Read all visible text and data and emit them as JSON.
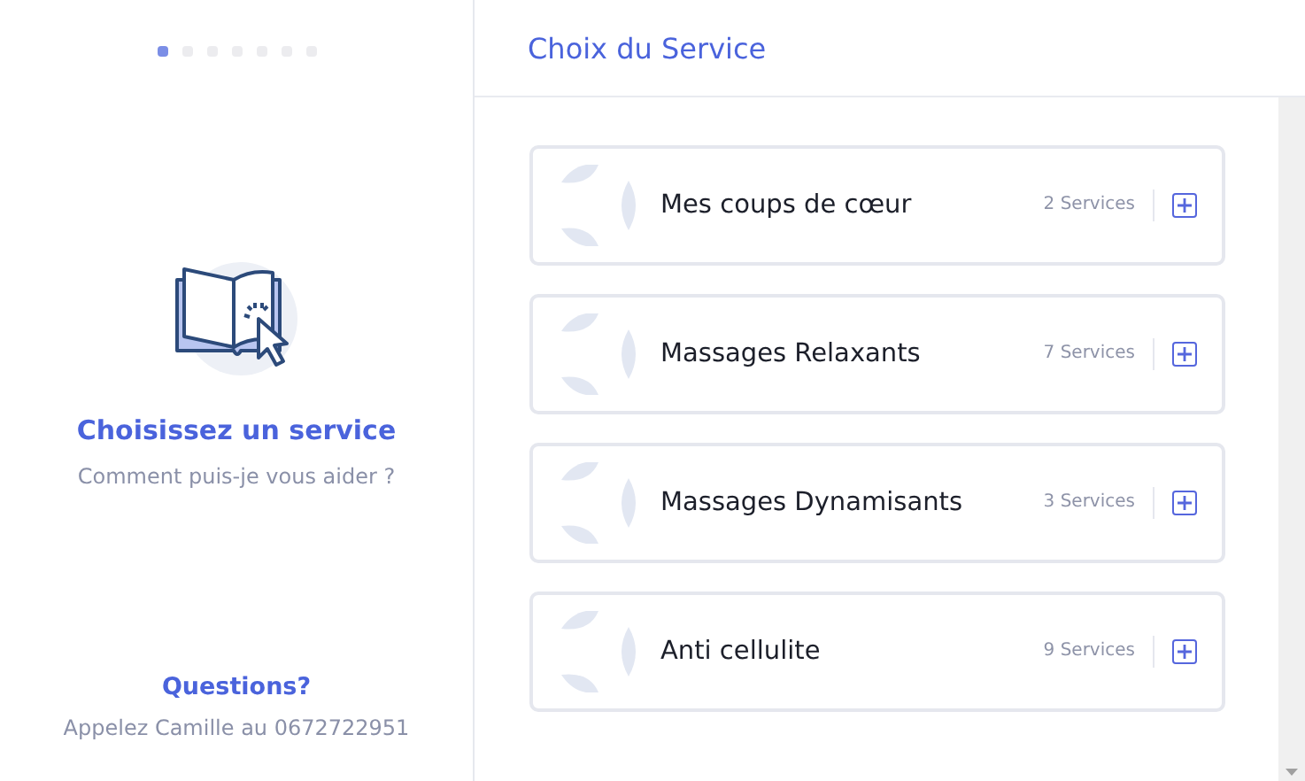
{
  "steps": [
    {
      "selected": true
    },
    {
      "selected": false
    },
    {
      "selected": false
    },
    {
      "selected": false
    },
    {
      "selected": false
    },
    {
      "selected": false
    },
    {
      "selected": false
    }
  ],
  "intro": {
    "title": "Choisissez un service",
    "subtitle": "Comment puis-je vous aider ?"
  },
  "contact": {
    "title": "Questions?",
    "text": "Appelez Camille au 0672722951"
  },
  "header": {
    "title": "Choix du Service"
  },
  "categories": [
    {
      "name": "Mes coups de cœur",
      "count": "2 Services"
    },
    {
      "name": "Massages Relaxants",
      "count": "7 Services"
    },
    {
      "name": "Massages Dynamisants",
      "count": "3 Services"
    },
    {
      "name": "Anti cellulite",
      "count": "9 Services"
    }
  ]
}
